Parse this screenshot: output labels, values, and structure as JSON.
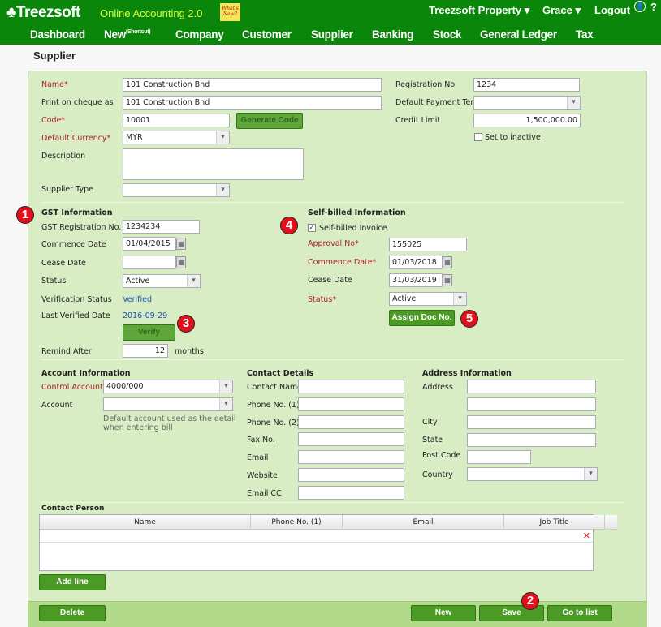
{
  "header": {
    "logo": "Treezsoft",
    "tagline": "Online Accounting 2.0",
    "whats_new": "What's New?",
    "company": "Treezsoft Property ▾",
    "user": "Grace ▾",
    "logout": "Logout",
    "help": "?"
  },
  "nav": [
    {
      "label": "Dashboard"
    },
    {
      "label": "New",
      "sup": "(Shortcut)"
    },
    {
      "label": "Company"
    },
    {
      "label": "Customer"
    },
    {
      "label": "Supplier"
    },
    {
      "label": "Banking"
    },
    {
      "label": "Stock"
    },
    {
      "label": "General Ledger"
    },
    {
      "label": "Tax"
    }
  ],
  "page_title": "Supplier",
  "general": {
    "name_label": "Name",
    "name": "101 Construction Bhd",
    "cheque_label": "Print on cheque as",
    "cheque": "101 Construction Bhd",
    "code_label": "Code",
    "code": "10001",
    "generate_code": "Generate Code",
    "currency_label": "Default Currency",
    "currency": "MYR",
    "description_label": "Description",
    "description": "",
    "supplier_type_label": "Supplier Type",
    "supplier_type": "",
    "reg_label": "Registration No",
    "reg": "1234",
    "payment_term_label": "Default Payment Term",
    "payment_term": "",
    "credit_limit_label": "Credit Limit",
    "credit_limit": "1,500,000.00",
    "inactive_label": "Set to inactive",
    "inactive": false
  },
  "gst": {
    "title": "GST Information",
    "reg_label": "GST Registration No.",
    "reg": "1234234",
    "commence_label": "Commence Date",
    "commence": "01/04/2015",
    "cease_label": "Cease Date",
    "cease": "",
    "status_label": "Status",
    "status": "Active",
    "verification_label": "Verification Status",
    "verification": "Verified",
    "last_verified_label": "Last Verified Date",
    "last_verified": "2016-09-29",
    "verify": "Verify",
    "remind_label": "Remind After",
    "remind": "12",
    "remind_unit": "months"
  },
  "self_billed": {
    "title": "Self-billed Information",
    "invoice_label": "Self-billed Invoice",
    "invoice": true,
    "approval_label": "Approval No",
    "approval": "155025",
    "commence_label": "Commence Date",
    "commence": "01/03/2018",
    "cease_label": "Cease Date",
    "cease": "31/03/2019",
    "status_label": "Status",
    "status": "Active",
    "assign": "Assign Doc No."
  },
  "account": {
    "title": "Account Information",
    "control_label": "Control Account",
    "control": "4000/000",
    "account_label": "Account",
    "account": "",
    "hint": "Default account used as the detail when entering bill"
  },
  "contact": {
    "title": "Contact Details",
    "fields": [
      {
        "label": "Contact Name",
        "value": ""
      },
      {
        "label": "Phone No. (1)",
        "value": ""
      },
      {
        "label": "Phone No. (2)",
        "value": ""
      },
      {
        "label": "Fax No.",
        "value": ""
      },
      {
        "label": "Email",
        "value": ""
      },
      {
        "label": "Website",
        "value": ""
      },
      {
        "label": "Email CC",
        "value": ""
      }
    ]
  },
  "address": {
    "title": "Address Information",
    "address_label": "Address",
    "address1": "",
    "address2": "",
    "city_label": "City",
    "city": "",
    "state_label": "State",
    "state": "",
    "postcode_label": "Post Code",
    "postcode": "",
    "country_label": "Country",
    "country": ""
  },
  "contact_person": {
    "title": "Contact Person",
    "columns": [
      "Name",
      "Phone No. (1)",
      "Email",
      "Job Title"
    ],
    "add_line": "Add line"
  },
  "footer": {
    "delete": "Delete",
    "new": "New",
    "save": "Save",
    "go_to_list": "Go to list"
  },
  "badges": [
    "1",
    "2",
    "3",
    "4",
    "5"
  ],
  "colors": {
    "header": "#0a870a",
    "panel": "#d8edc4",
    "button": "#4a9a24",
    "required": "#b0202a",
    "badge": "#e0101a"
  }
}
